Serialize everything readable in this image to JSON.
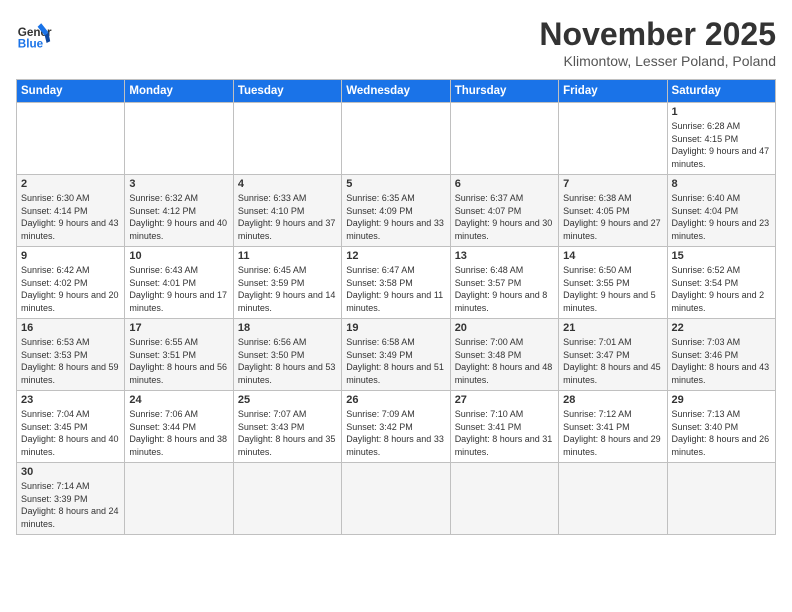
{
  "logo": {
    "text_general": "General",
    "text_blue": "Blue"
  },
  "title": "November 2025",
  "subtitle": "Klimontow, Lesser Poland, Poland",
  "headers": [
    "Sunday",
    "Monday",
    "Tuesday",
    "Wednesday",
    "Thursday",
    "Friday",
    "Saturday"
  ],
  "weeks": [
    [
      {
        "day": "",
        "info": ""
      },
      {
        "day": "",
        "info": ""
      },
      {
        "day": "",
        "info": ""
      },
      {
        "day": "",
        "info": ""
      },
      {
        "day": "",
        "info": ""
      },
      {
        "day": "",
        "info": ""
      },
      {
        "day": "1",
        "info": "Sunrise: 6:28 AM\nSunset: 4:15 PM\nDaylight: 9 hours and 47 minutes."
      }
    ],
    [
      {
        "day": "2",
        "info": "Sunrise: 6:30 AM\nSunset: 4:14 PM\nDaylight: 9 hours and 43 minutes."
      },
      {
        "day": "3",
        "info": "Sunrise: 6:32 AM\nSunset: 4:12 PM\nDaylight: 9 hours and 40 minutes."
      },
      {
        "day": "4",
        "info": "Sunrise: 6:33 AM\nSunset: 4:10 PM\nDaylight: 9 hours and 37 minutes."
      },
      {
        "day": "5",
        "info": "Sunrise: 6:35 AM\nSunset: 4:09 PM\nDaylight: 9 hours and 33 minutes."
      },
      {
        "day": "6",
        "info": "Sunrise: 6:37 AM\nSunset: 4:07 PM\nDaylight: 9 hours and 30 minutes."
      },
      {
        "day": "7",
        "info": "Sunrise: 6:38 AM\nSunset: 4:05 PM\nDaylight: 9 hours and 27 minutes."
      },
      {
        "day": "8",
        "info": "Sunrise: 6:40 AM\nSunset: 4:04 PM\nDaylight: 9 hours and 23 minutes."
      }
    ],
    [
      {
        "day": "9",
        "info": "Sunrise: 6:42 AM\nSunset: 4:02 PM\nDaylight: 9 hours and 20 minutes."
      },
      {
        "day": "10",
        "info": "Sunrise: 6:43 AM\nSunset: 4:01 PM\nDaylight: 9 hours and 17 minutes."
      },
      {
        "day": "11",
        "info": "Sunrise: 6:45 AM\nSunset: 3:59 PM\nDaylight: 9 hours and 14 minutes."
      },
      {
        "day": "12",
        "info": "Sunrise: 6:47 AM\nSunset: 3:58 PM\nDaylight: 9 hours and 11 minutes."
      },
      {
        "day": "13",
        "info": "Sunrise: 6:48 AM\nSunset: 3:57 PM\nDaylight: 9 hours and 8 minutes."
      },
      {
        "day": "14",
        "info": "Sunrise: 6:50 AM\nSunset: 3:55 PM\nDaylight: 9 hours and 5 minutes."
      },
      {
        "day": "15",
        "info": "Sunrise: 6:52 AM\nSunset: 3:54 PM\nDaylight: 9 hours and 2 minutes."
      }
    ],
    [
      {
        "day": "16",
        "info": "Sunrise: 6:53 AM\nSunset: 3:53 PM\nDaylight: 8 hours and 59 minutes."
      },
      {
        "day": "17",
        "info": "Sunrise: 6:55 AM\nSunset: 3:51 PM\nDaylight: 8 hours and 56 minutes."
      },
      {
        "day": "18",
        "info": "Sunrise: 6:56 AM\nSunset: 3:50 PM\nDaylight: 8 hours and 53 minutes."
      },
      {
        "day": "19",
        "info": "Sunrise: 6:58 AM\nSunset: 3:49 PM\nDaylight: 8 hours and 51 minutes."
      },
      {
        "day": "20",
        "info": "Sunrise: 7:00 AM\nSunset: 3:48 PM\nDaylight: 8 hours and 48 minutes."
      },
      {
        "day": "21",
        "info": "Sunrise: 7:01 AM\nSunset: 3:47 PM\nDaylight: 8 hours and 45 minutes."
      },
      {
        "day": "22",
        "info": "Sunrise: 7:03 AM\nSunset: 3:46 PM\nDaylight: 8 hours and 43 minutes."
      }
    ],
    [
      {
        "day": "23",
        "info": "Sunrise: 7:04 AM\nSunset: 3:45 PM\nDaylight: 8 hours and 40 minutes."
      },
      {
        "day": "24",
        "info": "Sunrise: 7:06 AM\nSunset: 3:44 PM\nDaylight: 8 hours and 38 minutes."
      },
      {
        "day": "25",
        "info": "Sunrise: 7:07 AM\nSunset: 3:43 PM\nDaylight: 8 hours and 35 minutes."
      },
      {
        "day": "26",
        "info": "Sunrise: 7:09 AM\nSunset: 3:42 PM\nDaylight: 8 hours and 33 minutes."
      },
      {
        "day": "27",
        "info": "Sunrise: 7:10 AM\nSunset: 3:41 PM\nDaylight: 8 hours and 31 minutes."
      },
      {
        "day": "28",
        "info": "Sunrise: 7:12 AM\nSunset: 3:41 PM\nDaylight: 8 hours and 29 minutes."
      },
      {
        "day": "29",
        "info": "Sunrise: 7:13 AM\nSunset: 3:40 PM\nDaylight: 8 hours and 26 minutes."
      }
    ],
    [
      {
        "day": "30",
        "info": "Sunrise: 7:14 AM\nSunset: 3:39 PM\nDaylight: 8 hours and 24 minutes."
      },
      {
        "day": "",
        "info": ""
      },
      {
        "day": "",
        "info": ""
      },
      {
        "day": "",
        "info": ""
      },
      {
        "day": "",
        "info": ""
      },
      {
        "day": "",
        "info": ""
      },
      {
        "day": "",
        "info": ""
      }
    ]
  ]
}
